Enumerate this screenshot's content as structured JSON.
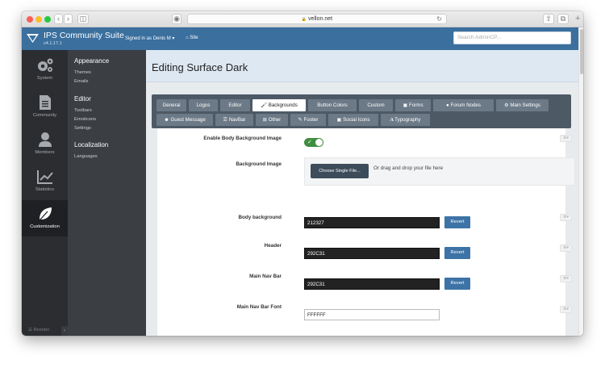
{
  "browser": {
    "url": "vellon.net",
    "lock": "🔒"
  },
  "header": {
    "brand": "IPS Community Suite",
    "version": "v4.1.17.1",
    "signed_in": "Signed in as Denis M ▾",
    "site_link": "Site",
    "search_placeholder": "Search AdminCP..."
  },
  "rail": {
    "items": [
      {
        "label": "System",
        "icon": "gears-icon"
      },
      {
        "label": "Community",
        "icon": "document-icon"
      },
      {
        "label": "Members",
        "icon": "user-icon"
      },
      {
        "label": "Statistics",
        "icon": "chart-icon"
      },
      {
        "label": "Customization",
        "icon": "leaf-icon",
        "active": true
      }
    ],
    "reorder": "Reorder"
  },
  "submenu": {
    "sections": [
      {
        "heading": "Appearance",
        "items": [
          "Themes",
          "Emails"
        ]
      },
      {
        "heading": "Editor",
        "items": [
          "Toolbars",
          "Emoticons",
          "Settings"
        ]
      },
      {
        "heading": "Localization",
        "items": [
          "Languages"
        ]
      }
    ]
  },
  "page": {
    "title": "Editing Surface Dark"
  },
  "tabs": {
    "row1": [
      "General",
      "Logos",
      "Editor",
      "Backgrounds",
      "Button Colors",
      "Custom",
      "Forms",
      "Forum Nodes",
      "Main Settings"
    ],
    "row2": [
      "Guest Message",
      "NavBar",
      "Other",
      "Footer",
      "Social Icons",
      "Typography"
    ],
    "active": "Backgrounds"
  },
  "form": {
    "enable_body_bg_label": "Enable Body Background Image",
    "enable_body_bg_value": true,
    "background_image_label": "Background Image",
    "choose_file": "Choose Single File...",
    "drop_text": "Or drag and drop your file here",
    "body_background_label": "Body background",
    "body_background_value": "212327",
    "header_label": "Header",
    "header_value": "292C31",
    "main_nav_label": "Main Nav Bar",
    "main_nav_value": "292C31",
    "main_nav_font_label": "Main Nav Bar Font",
    "main_nav_font_value": "FFFFFF",
    "revert": "Revert"
  },
  "colors": {
    "accent": "#3a6f9e",
    "toggle_on": "#3e8e3f",
    "revert_button": "#3d73a6"
  }
}
